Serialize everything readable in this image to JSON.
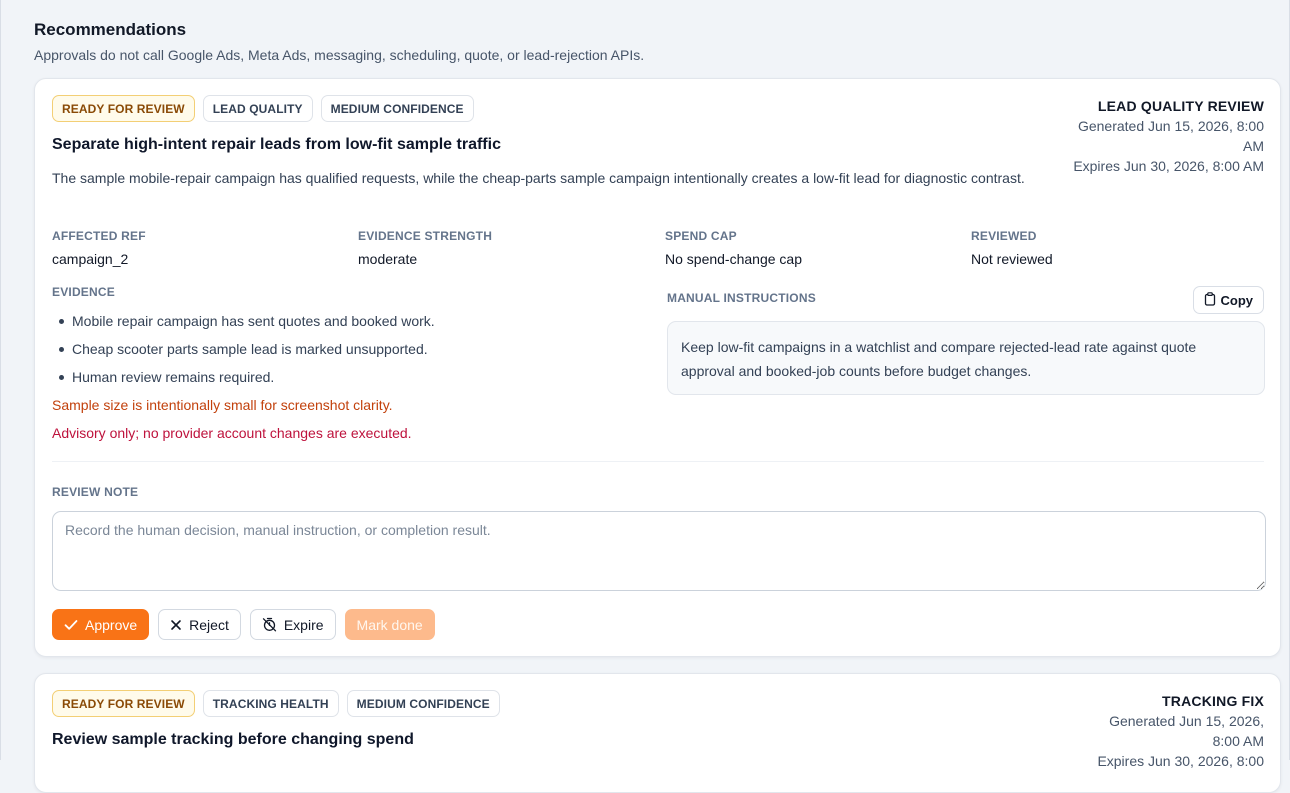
{
  "section": {
    "title": "Recommendations",
    "subtitle": "Approvals do not call Google Ads, Meta Ads, messaging, scheduling, quote, or lead-rejection APIs."
  },
  "cards": [
    {
      "badges": [
        "READY FOR REVIEW",
        "LEAD QUALITY",
        "MEDIUM CONFIDENCE"
      ],
      "type_label": "LEAD QUALITY REVIEW",
      "generated_line1": "Generated Jun 15, 2026, 8:00",
      "generated_line2": "AM",
      "expires": "Expires Jun 30, 2026, 8:00 AM",
      "title": "Separate high-intent repair leads from low-fit sample traffic",
      "description": "The sample mobile-repair campaign has qualified requests, while the cheap-parts sample campaign intentionally creates a low-fit lead for diagnostic contrast.",
      "fields": [
        {
          "label": "AFFECTED REF",
          "value": "campaign_2"
        },
        {
          "label": "EVIDENCE STRENGTH",
          "value": "moderate"
        },
        {
          "label": "SPEND CAP",
          "value": "No spend-change cap"
        },
        {
          "label": "REVIEWED",
          "value": "Not reviewed"
        }
      ],
      "evidence_label": "EVIDENCE",
      "evidence": [
        "Mobile repair campaign has sent quotes and booked work.",
        "Cheap scooter parts sample lead is marked unsupported.",
        "Human review remains required."
      ],
      "warning": "Sample size is intentionally small for screenshot clarity.",
      "advisory": "Advisory only; no provider account changes are executed.",
      "manual_label": "MANUAL INSTRUCTIONS",
      "copy_label": "Copy",
      "manual_text": "Keep low-fit campaigns in a watchlist and compare rejected-lead rate against quote approval and booked-job counts before budget changes.",
      "review_note_label": "REVIEW NOTE",
      "review_note_placeholder": "Record the human decision, manual instruction, or completion result.",
      "actions": {
        "approve": "Approve",
        "reject": "Reject",
        "expire": "Expire",
        "done": "Mark done"
      }
    },
    {
      "badges": [
        "READY FOR REVIEW",
        "TRACKING HEALTH",
        "MEDIUM CONFIDENCE"
      ],
      "type_label": "TRACKING FIX",
      "generated_line1": "Generated Jun 15, 2026,",
      "generated_line2": "8:00 AM",
      "expires": "Expires Jun 30, 2026, 8:00",
      "title": "Review sample tracking before changing spend"
    }
  ],
  "colors": {
    "accent": "#f97316",
    "ready_bg": "#fffbeb",
    "ready_text": "#8a4a06",
    "warning": "#c2410c",
    "advisory": "#be123c"
  }
}
